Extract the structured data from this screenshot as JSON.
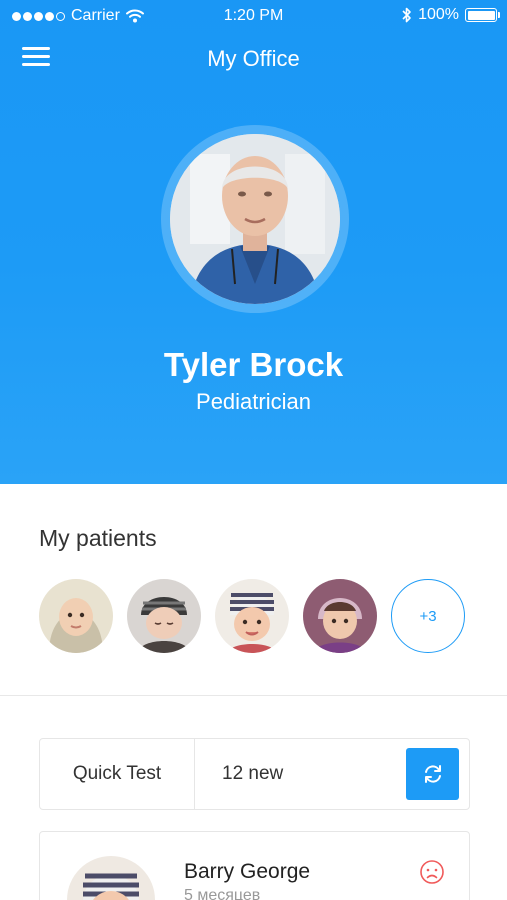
{
  "status_bar": {
    "carrier": "Carrier",
    "time": "1:20 PM",
    "battery": "100%",
    "battery_level": 1.0,
    "signal_dots_filled": 4,
    "signal_dots_total": 5
  },
  "nav": {
    "title": "My Office",
    "menu_icon": "hamburger-menu-icon"
  },
  "profile": {
    "name": "Tyler Brock",
    "role": "Pediatrician"
  },
  "patients": {
    "title": "My patients",
    "more_label": "+3",
    "avatars": [
      "baby-avatar-1",
      "baby-avatar-2",
      "baby-avatar-3",
      "baby-avatar-4"
    ]
  },
  "quick_test": {
    "label": "Quick Test",
    "count": "12 new",
    "refresh_icon": "refresh-icon"
  },
  "patient_card": {
    "name": "Barry George",
    "age": "5 месяцев",
    "status_icon": "sad-face-icon"
  },
  "colors": {
    "accent": "#1d9bf6",
    "alert": "#f05a5a"
  }
}
